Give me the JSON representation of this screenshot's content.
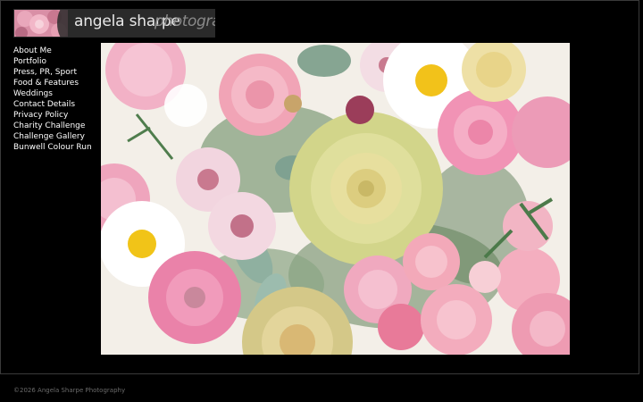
{
  "header": {
    "name": "angela sharpe",
    "tagline": "photography"
  },
  "nav": {
    "items": [
      {
        "label": "About Me"
      },
      {
        "label": "Portfolio"
      },
      {
        "label": "Press, PR, Sport"
      },
      {
        "label": "Food & Features"
      },
      {
        "label": "Weddings"
      },
      {
        "label": "Contact Details"
      },
      {
        "label": "Privacy Policy"
      },
      {
        "label": "Charity Challenge"
      },
      {
        "label": "Challenge Gallery"
      },
      {
        "label": "Bunwell Colour Run"
      }
    ]
  },
  "photo": {
    "subject_icon": "flower-bouquet-photo"
  },
  "footer": {
    "copyright": "©2026 Angela Sharpe Photography"
  },
  "colors": {
    "background": "#000000",
    "nav_text": "#ffffff",
    "footer_text": "#6b6b6b",
    "logo_bg": "#2a2a2a"
  }
}
